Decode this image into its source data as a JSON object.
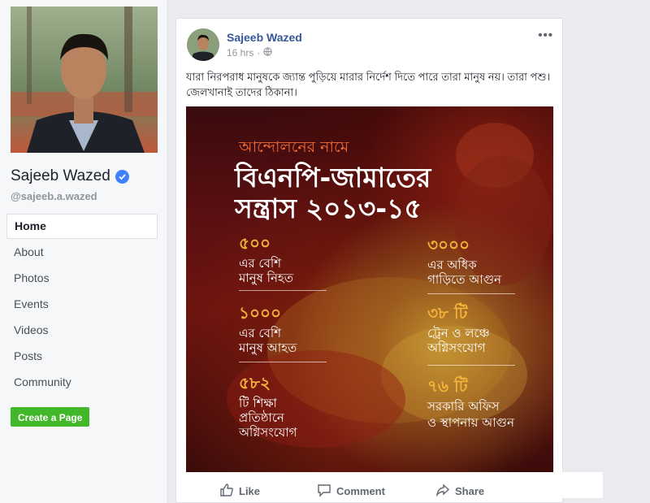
{
  "profile": {
    "name": "Sajeeb Wazed",
    "handle": "@sajeeb.a.wazed"
  },
  "nav": {
    "items": [
      {
        "label": "Home",
        "active": true
      },
      {
        "label": "About"
      },
      {
        "label": "Photos"
      },
      {
        "label": "Events"
      },
      {
        "label": "Videos"
      },
      {
        "label": "Posts"
      },
      {
        "label": "Community"
      }
    ]
  },
  "create_page_label": "Create a Page",
  "post": {
    "author": "Sajeeb Wazed",
    "time": "16 hrs",
    "separator": "·",
    "text": "যারা নিরপরাধ মানুষকে জ্যান্ত পুড়িয়ে মারার নির্দেশ দিতে পারে তারা মানুষ নয়। তারা পশু। জেলখানাই তাদের ঠিকানা।",
    "image": {
      "kicker": "আন্দোলনের নামে",
      "headline_line1": "বিএনপি-জামাতের",
      "headline_line2": "সন্ত্রাস ২০১৩-১৫",
      "stats_left": [
        {
          "number": "৫০০",
          "line1": "এর বেশি",
          "line2": "মানুষ নিহত"
        },
        {
          "number": "১০০০",
          "line1": "এর বেশি",
          "line2": "মানুষ আহত"
        },
        {
          "number": "৫৮২",
          "line1": "টি শিক্ষা",
          "line2": "প্রতিষ্ঠানে",
          "line3": "অগ্নিসংযোগ"
        }
      ],
      "stats_right": [
        {
          "number": "৩০০০",
          "line1": "এর অধিক",
          "line2": "গাড়িতে আগুন"
        },
        {
          "number": "৩৮ টি",
          "line1": "ট্রেন ও লঞ্চে",
          "line2": "অগ্নিসংযোগ"
        },
        {
          "number": "৭৬ টি",
          "line1": "সরকারি অফিস",
          "line2": "ও স্থাপনায় আগুন"
        }
      ]
    },
    "actions": {
      "like": "Like",
      "comment": "Comment",
      "share": "Share"
    }
  },
  "colors": {
    "link": "#365899",
    "verified": "#4080ff",
    "create_page": "#42b72a",
    "stat_number": "#f3b23a",
    "kicker": "#f06a36"
  },
  "icons": [
    "verified-icon",
    "globe-icon",
    "more-icon",
    "like-icon",
    "comment-icon",
    "share-icon"
  ]
}
